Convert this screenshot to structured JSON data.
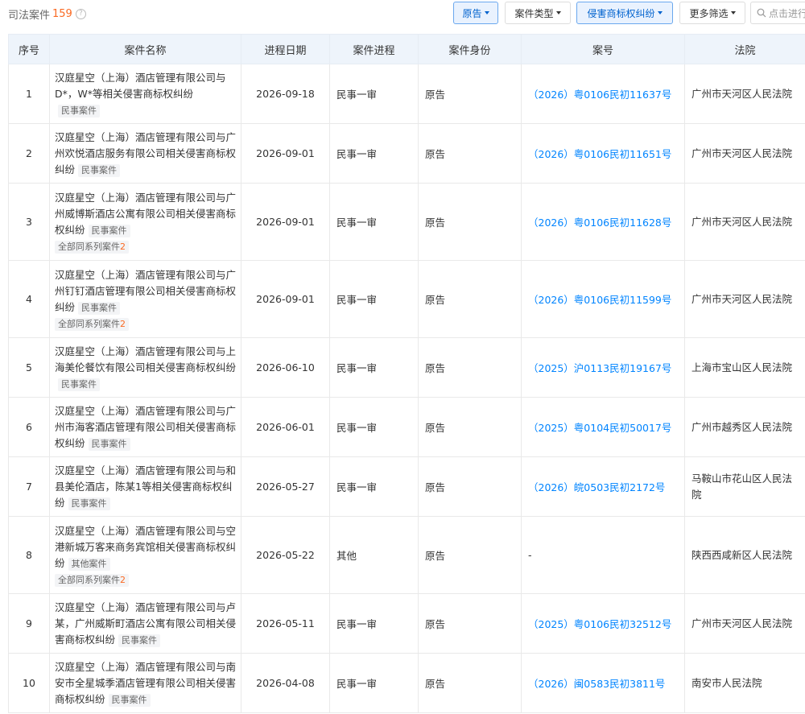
{
  "header": {
    "title": "司法案件",
    "count": "159",
    "info_icon": "?"
  },
  "filters": {
    "role": "原告",
    "case_type": "案件类型",
    "cause": "侵害商标权纠纷",
    "more": "更多筛选",
    "search_placeholder": "点击进行搜索"
  },
  "columns": [
    "序号",
    "案件名称",
    "进程日期",
    "案件进程",
    "案件身份",
    "案号",
    "法院"
  ],
  "rows": [
    {
      "no": "1",
      "name": "汉庭星空（上海）酒店管理有限公司与D*，W*等相关侵害商标权纠纷",
      "tag": "民事案件",
      "series_label": "",
      "series_count": "",
      "date": "2026-09-18",
      "stage": "民事一审",
      "role": "原告",
      "case_no": "（2026）粤0106民初11637号",
      "court": "广州市天河区人民法院"
    },
    {
      "no": "2",
      "name": "汉庭星空（上海）酒店管理有限公司与广州欢悦酒店服务有限公司相关侵害商标权纠纷",
      "tag": "民事案件",
      "series_label": "",
      "series_count": "",
      "date": "2026-09-01",
      "stage": "民事一审",
      "role": "原告",
      "case_no": "（2026）粤0106民初11651号",
      "court": "广州市天河区人民法院"
    },
    {
      "no": "3",
      "name": "汉庭星空（上海）酒店管理有限公司与广州威博斯酒店公寓有限公司相关侵害商标权纠纷",
      "tag": "民事案件",
      "series_label": "全部同系列案件",
      "series_count": "2",
      "date": "2026-09-01",
      "stage": "民事一审",
      "role": "原告",
      "case_no": "（2026）粤0106民初11628号",
      "court": "广州市天河区人民法院"
    },
    {
      "no": "4",
      "name": "汉庭星空（上海）酒店管理有限公司与广州钉钉酒店管理有限公司相关侵害商标权纠纷",
      "tag": "民事案件",
      "series_label": "全部同系列案件",
      "series_count": "2",
      "date": "2026-09-01",
      "stage": "民事一审",
      "role": "原告",
      "case_no": "（2026）粤0106民初11599号",
      "court": "广州市天河区人民法院"
    },
    {
      "no": "5",
      "name": "汉庭星空（上海）酒店管理有限公司与上海美伦餐饮有限公司相关侵害商标权纠纷",
      "tag": "民事案件",
      "series_label": "",
      "series_count": "",
      "date": "2026-06-10",
      "stage": "民事一审",
      "role": "原告",
      "case_no": "（2025）沪0113民初19167号",
      "court": "上海市宝山区人民法院"
    },
    {
      "no": "6",
      "name": "汉庭星空（上海）酒店管理有限公司与广州市海客酒店管理有限公司相关侵害商标权纠纷",
      "tag": "民事案件",
      "series_label": "",
      "series_count": "",
      "date": "2026-06-01",
      "stage": "民事一审",
      "role": "原告",
      "case_no": "（2025）粤0104民初50017号",
      "court": "广州市越秀区人民法院"
    },
    {
      "no": "7",
      "name": "汉庭星空（上海）酒店管理有限公司与和县美伦酒店，陈某1等相关侵害商标权纠纷",
      "tag": "民事案件",
      "series_label": "",
      "series_count": "",
      "date": "2026-05-27",
      "stage": "民事一审",
      "role": "原告",
      "case_no": "（2026）皖0503民初2172号",
      "court": "马鞍山市花山区人民法院"
    },
    {
      "no": "8",
      "name": "汉庭星空（上海）酒店管理有限公司与空港新城万客来商务宾馆相关侵害商标权纠纷",
      "tag": "其他案件",
      "series_label": "全部同系列案件",
      "series_count": "2",
      "date": "2026-05-22",
      "stage": "其他",
      "role": "原告",
      "case_no": "-",
      "court": "陕西西咸新区人民法院"
    },
    {
      "no": "9",
      "name": "汉庭星空（上海）酒店管理有限公司与卢某，广州威斯町酒店公寓有限公司相关侵害商标权纠纷",
      "tag": "民事案件",
      "series_label": "",
      "series_count": "",
      "date": "2026-05-11",
      "stage": "民事一审",
      "role": "原告",
      "case_no": "（2025）粤0106民初32512号",
      "court": "广州市天河区人民法院"
    },
    {
      "no": "10",
      "name": "汉庭星空（上海）酒店管理有限公司与南安市全星城季酒店管理有限公司相关侵害商标权纠纷",
      "tag": "民事案件",
      "series_label": "",
      "series_count": "",
      "date": "2026-04-08",
      "stage": "民事一审",
      "role": "原告",
      "case_no": "（2026）闽0583民初3811号",
      "court": "南安市人民法院"
    }
  ],
  "colors": {
    "accent": "#0084ff",
    "count": "#fa6a23",
    "header_bg": "#eef4fb",
    "active_filter_bg": "#e9f2fe"
  }
}
